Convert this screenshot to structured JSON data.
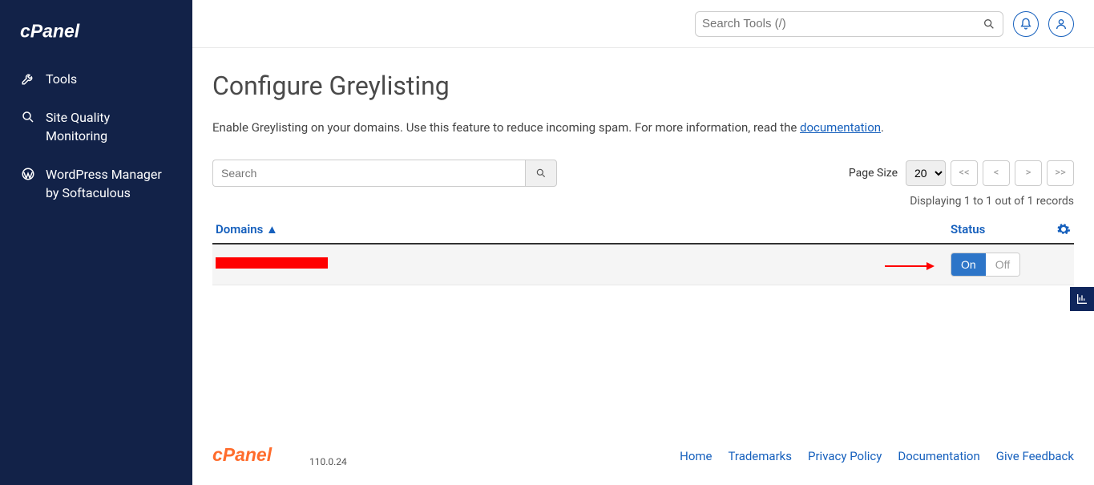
{
  "sidebar": {
    "items": [
      {
        "label": "Tools"
      },
      {
        "label": "Site Quality Monitoring"
      },
      {
        "label": "WordPress Manager by Softaculous"
      }
    ]
  },
  "topbar": {
    "search_placeholder": "Search Tools (/)"
  },
  "page": {
    "title": "Configure Greylisting",
    "desc_pre": "Enable Greylisting on your domains. Use this feature to reduce incoming spam. For more information, read the ",
    "doc_link": "documentation",
    "desc_post": "."
  },
  "search": {
    "placeholder": "Search"
  },
  "pager": {
    "label": "Page Size",
    "size": "20",
    "first": "<<",
    "prev": "<",
    "next": ">",
    "last": ">>"
  },
  "display_count": "Displaying 1 to 1 out of 1 records",
  "table": {
    "col_domains": "Domains ▲",
    "col_status": "Status",
    "rows": [
      {
        "on": "On",
        "off": "Off"
      }
    ]
  },
  "footer": {
    "version": "110.0.24",
    "links": [
      {
        "label": "Home"
      },
      {
        "label": "Trademarks"
      },
      {
        "label": "Privacy Policy"
      },
      {
        "label": "Documentation"
      },
      {
        "label": "Give Feedback"
      }
    ]
  }
}
